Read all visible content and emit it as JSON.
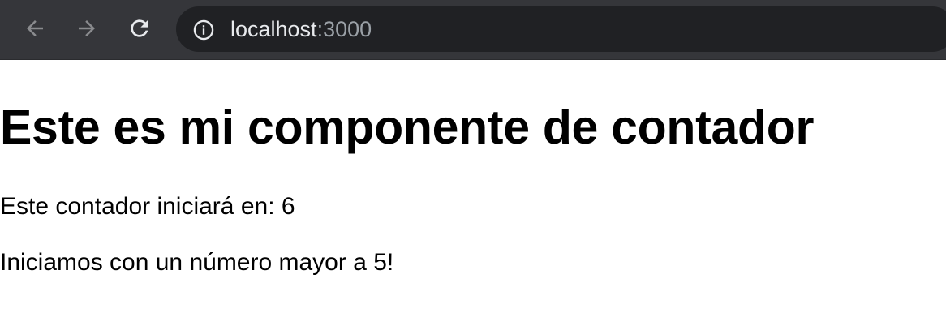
{
  "browser": {
    "back_icon": "arrow-left-icon",
    "forward_icon": "arrow-right-icon",
    "reload_icon": "reload-icon",
    "site_info_icon": "info-circle-icon",
    "url_host": "localhost",
    "url_port": ":3000",
    "colors": {
      "toolbar": "#35363a",
      "omnibox": "#202124",
      "url_host": "#e8eaed",
      "url_port": "#9aa0a6",
      "icon_enabled": "#e8eaed",
      "icon_disabled": "#8a8b8e"
    }
  },
  "page": {
    "heading": "Este es mi componente de contador",
    "counter_text": "Este contador iniciará en: 6",
    "message": "Iniciamos con un número mayor a 5!"
  }
}
